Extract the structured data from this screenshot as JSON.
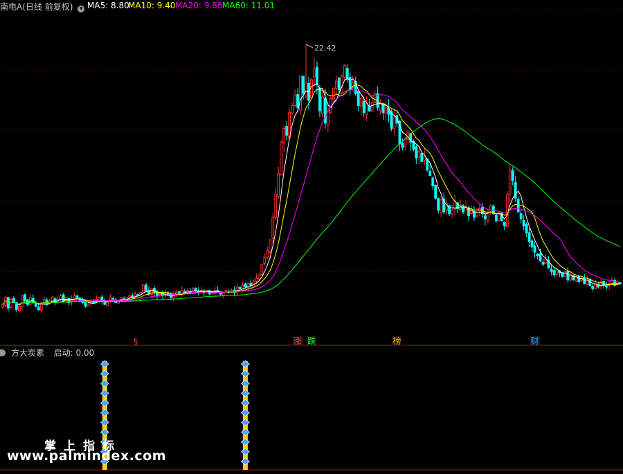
{
  "header": {
    "stock_title": "南电A(日线 前复权)",
    "title_color": "#c8c8c8",
    "ma_items": [
      {
        "label": "MA5: 8.80",
        "color": "#ffffff"
      },
      {
        "label": "MA10: 9.40",
        "color": "#ffff00"
      },
      {
        "label": "MA20: 9.86",
        "color": "#ff00ff"
      },
      {
        "label": "MA60: 11.01",
        "color": "#00ff00"
      }
    ]
  },
  "indicator": {
    "name": "方大炭素",
    "signal_label": "启动: 0.00",
    "name_color": "#c8c8c8",
    "signal_color": "#ff3030"
  },
  "markers": [
    {
      "text": "§",
      "color": "#ff3030",
      "bg": "",
      "day": 49
    },
    {
      "text": "涨",
      "color": "#ff3030",
      "bg": "#1a1a1a",
      "day": 107
    },
    {
      "text": "跌",
      "color": "#00ff00",
      "bg": "#1a1a1a",
      "day": 112
    },
    {
      "text": "榜",
      "color": "#ff9900",
      "bg": "#1a1a1a",
      "day": 143
    },
    {
      "text": "财",
      "color": "#3399ff",
      "bg": "#1a1a1a",
      "day": 193
    }
  ],
  "watermark": {
    "cn": "掌上指标",
    "url": "www.palmindex.com"
  },
  "colors": {
    "up": "#ff3030",
    "down": "#00ffff",
    "ma5": "#ffffff",
    "ma10": "#ffff00",
    "ma20": "#ff00ff",
    "ma60": "#00ff00",
    "grid": "#8b0000",
    "divider": "#cc0000"
  },
  "chart_data": {
    "type": "candlestick",
    "title": "南电A(日线 前复权)",
    "xlabel": "",
    "ylabel": "",
    "ylim": [
      5.2,
      24.4
    ],
    "grid": true,
    "max_annotation": {
      "label": "22.42",
      "value": 22.42,
      "day": 110
    },
    "close": [
      7.5,
      7.9,
      7.3,
      7.8,
      7.6,
      7.2,
      7.4,
      8.0,
      7.7,
      7.5,
      7.9,
      7.6,
      7.4,
      7.2,
      7.6,
      7.8,
      7.5,
      7.7,
      7.9,
      7.6,
      7.8,
      8.0,
      7.7,
      7.9,
      7.6,
      7.8,
      8.0,
      7.9,
      7.7,
      7.6,
      7.4,
      7.5,
      7.7,
      7.6,
      7.8,
      7.9,
      7.7,
      7.5,
      7.7,
      7.9,
      7.8,
      7.6,
      7.7,
      7.9,
      7.8,
      7.9,
      8.0,
      7.9,
      8.1,
      8.0,
      8.2,
      8.6,
      8.3,
      8.1,
      8.4,
      8.2,
      8.0,
      8.1,
      8.0,
      8.1,
      8.0,
      7.9,
      8.1,
      8.2,
      8.1,
      8.3,
      8.2,
      8.3,
      8.2,
      8.4,
      8.3,
      8.2,
      8.3,
      8.2,
      8.3,
      8.1,
      8.2,
      8.3,
      8.2,
      8.1,
      8.2,
      8.3,
      8.2,
      8.3,
      8.2,
      8.5,
      8.4,
      8.6,
      8.5,
      8.7,
      8.6,
      8.8,
      9.0,
      9.2,
      9.8,
      10.2,
      10.6,
      11.2,
      12.5,
      13.8,
      15.0,
      16.8,
      17.6,
      17.2,
      18.5,
      18.9,
      19.5,
      18.8,
      20.6,
      19.6,
      20.2,
      19.2,
      20.4,
      21.0,
      20.1,
      18.6,
      19.4,
      17.9,
      18.7,
      19.3,
      19.9,
      20.3,
      19.8,
      20.6,
      21.2,
      20.4,
      19.8,
      20.2,
      19.6,
      18.9,
      19.3,
      18.5,
      19.0,
      18.6,
      19.1,
      19.6,
      18.8,
      19.0,
      18.5,
      18.9,
      18.4,
      17.6,
      18.2,
      17.9,
      16.7,
      16.5,
      17.0,
      17.4,
      16.8,
      16.4,
      15.9,
      16.3,
      15.7,
      16.0,
      15.2,
      14.9,
      14.3,
      13.6,
      12.9,
      13.5,
      12.8,
      13.3,
      12.7,
      12.9,
      13.4,
      13.0,
      13.2,
      12.8,
      13.1,
      12.6,
      12.9,
      12.5,
      12.8,
      13.0,
      12.7,
      12.4,
      12.8,
      13.2,
      12.7,
      12.3,
      12.7,
      12.3,
      12.0,
      13.8,
      15.2,
      14.6,
      13.6,
      12.8,
      12.4,
      12.0,
      11.6,
      11.1,
      10.8,
      10.5,
      10.3,
      10.0,
      9.8,
      10.1,
      9.6,
      9.4,
      9.2,
      9.5,
      9.3,
      9.1,
      9.4,
      8.9,
      9.2,
      8.9,
      9.1,
      8.8,
      9.0,
      8.7,
      8.9,
      8.6,
      8.4,
      8.7,
      8.5,
      8.8,
      8.6,
      8.5,
      8.7,
      8.9,
      8.6,
      8.8,
      8.7
    ]
  },
  "indicator_data": {
    "signal_days": [
      37,
      88
    ],
    "signal_stack_count": 11
  }
}
